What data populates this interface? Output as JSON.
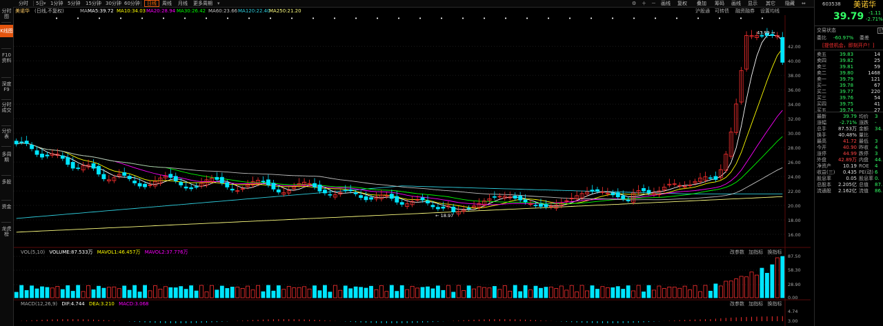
{
  "toolbar": {
    "periods": [
      "分时",
      "5日",
      "1分钟",
      "5分钟",
      "15分钟",
      "30分钟",
      "60分钟",
      "日线",
      "周线",
      "月线",
      "更多周期"
    ],
    "active_period": "日线",
    "right_items": [
      "画线",
      "复权",
      "叠加",
      "筹码",
      "画线",
      "显示",
      "其它",
      "隐藏"
    ],
    "icons": [
      "settings-icon",
      "plus-icon",
      "minus-icon"
    ]
  },
  "left_sidebar": [
    "分时图",
    "K线图",
    "F10资料",
    "深度F9",
    "分时成交",
    "分价表",
    "多周期",
    "多股",
    "资金",
    "龙虎榜"
  ],
  "left_sidebar_active": "K线图",
  "price_bar": {
    "name": "美诺华",
    "adjust": "(日线,不复权)",
    "ma_label": "MA",
    "ma": [
      {
        "label": "MA5:39.72",
        "color": "#ffffff"
      },
      {
        "label": "MA10:34.03",
        "color": "#ffff00"
      },
      {
        "label": "MA20:28.94",
        "color": "#ff00ff"
      },
      {
        "label": "MA30:26.42",
        "color": "#00ff00"
      },
      {
        "label": "MA60:23.66",
        "color": "#c0c0c0"
      },
      {
        "label": "MA120:22.40",
        "color": "#2fd0e0"
      },
      {
        "label": "MA250:21.20",
        "color": "#ffff80"
      }
    ],
    "right_links": [
      "沪股通",
      "可转债",
      "融资融券",
      "设置均线"
    ]
  },
  "price_axis": [
    "42.00",
    "40.00",
    "38.00",
    "36.00",
    "34.00",
    "32.00",
    "30.00",
    "28.00",
    "26.00",
    "24.00",
    "22.00",
    "20.00",
    "18.00",
    "16.00"
  ],
  "annotations": {
    "high": "43.99",
    "low": "18.97"
  },
  "volume_bar": {
    "label": "VOL(5,10)",
    "volume": "VOLUME:87.533万",
    "mavol1": "MAVOL1:46.457万",
    "mavol2": "MAVOL2:37.776万",
    "links": [
      "改参数",
      "加指标",
      "换指标"
    ],
    "axis": [
      "87.50",
      "58.30",
      "28.90",
      "0.00"
    ]
  },
  "macd_bar": {
    "label": "MACD(12,26,9)",
    "dif": "DIF:4.744",
    "dea": "DEA:3.210",
    "macd": "MACD:3.068",
    "links": [
      "改参数",
      "加指标",
      "换指标"
    ],
    "axis": [
      "4.74",
      "3.00"
    ]
  },
  "quote": {
    "code": "603538",
    "name": "美诺华",
    "price": "39.79",
    "change": "-1.11",
    "change_pct": "-2.71%",
    "status": "交易状态",
    "status_icon": "已",
    "webi_label": "委比",
    "webi_value": "-60.97%",
    "weicha_label": "委差",
    "promo": "[提佳机会，即刻开户！]",
    "asks": [
      {
        "label": "卖五",
        "price": "39.83",
        "vol": "14"
      },
      {
        "label": "卖四",
        "price": "39.82",
        "vol": "25"
      },
      {
        "label": "卖三",
        "price": "39.81",
        "vol": "59"
      },
      {
        "label": "卖二",
        "price": "39.80",
        "vol": "1468"
      },
      {
        "label": "卖一",
        "price": "39.79",
        "vol": "121"
      }
    ],
    "bids": [
      {
        "label": "买一",
        "price": "39.78",
        "vol": "67"
      },
      {
        "label": "买二",
        "price": "39.77",
        "vol": "220"
      },
      {
        "label": "买三",
        "price": "39.76",
        "vol": "54"
      },
      {
        "label": "买四",
        "price": "39.75",
        "vol": "41"
      },
      {
        "label": "买五",
        "price": "39.74",
        "vol": "27"
      }
    ],
    "stats": [
      {
        "l": "最新",
        "v": "39.79",
        "c": "#33ff66",
        "l2": "均价",
        "v2": "3"
      },
      {
        "l": "涨幅",
        "v": "-2.71%",
        "c": "#33ff66",
        "l2": "涨跌",
        "v2": "-"
      },
      {
        "l": "总手",
        "v": "87.53万",
        "c": "#e0e0e0",
        "l2": "金额",
        "v2": "34."
      },
      {
        "l": "换手",
        "v": "40.48%",
        "c": "#e0e0e0",
        "l2": "量比",
        "v2": ""
      },
      {
        "l": "最高",
        "v": "41.72",
        "c": "#ff4444",
        "l2": "最低",
        "v2": "3"
      },
      {
        "l": "今开",
        "v": "40.90",
        "c": "#ff4444",
        "l2": "昨收",
        "v2": "4"
      },
      {
        "l": "涨停",
        "v": "44.99",
        "c": "#ff4444",
        "l2": "跌停",
        "v2": "3"
      },
      {
        "l": "外盘",
        "v": "42.89万",
        "c": "#ff4444",
        "l2": "内盘",
        "v2": "44."
      },
      {
        "l": "净资产",
        "v": "10.19",
        "c": "#e0e0e0",
        "l2": "ROE",
        "v2": "4"
      },
      {
        "l": "收益(三)",
        "v": "0.435",
        "c": "#e0e0e0",
        "l2": "PE(动)",
        "v2": "6"
      },
      {
        "l": "股息率",
        "v": "0.05",
        "c": "#e0e0e0",
        "l2": "股息率",
        "v2": "0."
      },
      {
        "l": "总股本",
        "v": "2.205亿",
        "c": "#e0e0e0",
        "l2": "总值",
        "v2": "87."
      },
      {
        "l": "流通股",
        "v": "2.162亿",
        "c": "#e0e0e0",
        "l2": "流值",
        "v2": "86."
      }
    ]
  },
  "colors": {
    "up": "#ff3030",
    "down": "#00e5ff",
    "bg": "#000000",
    "accent": "#e3540e"
  }
}
